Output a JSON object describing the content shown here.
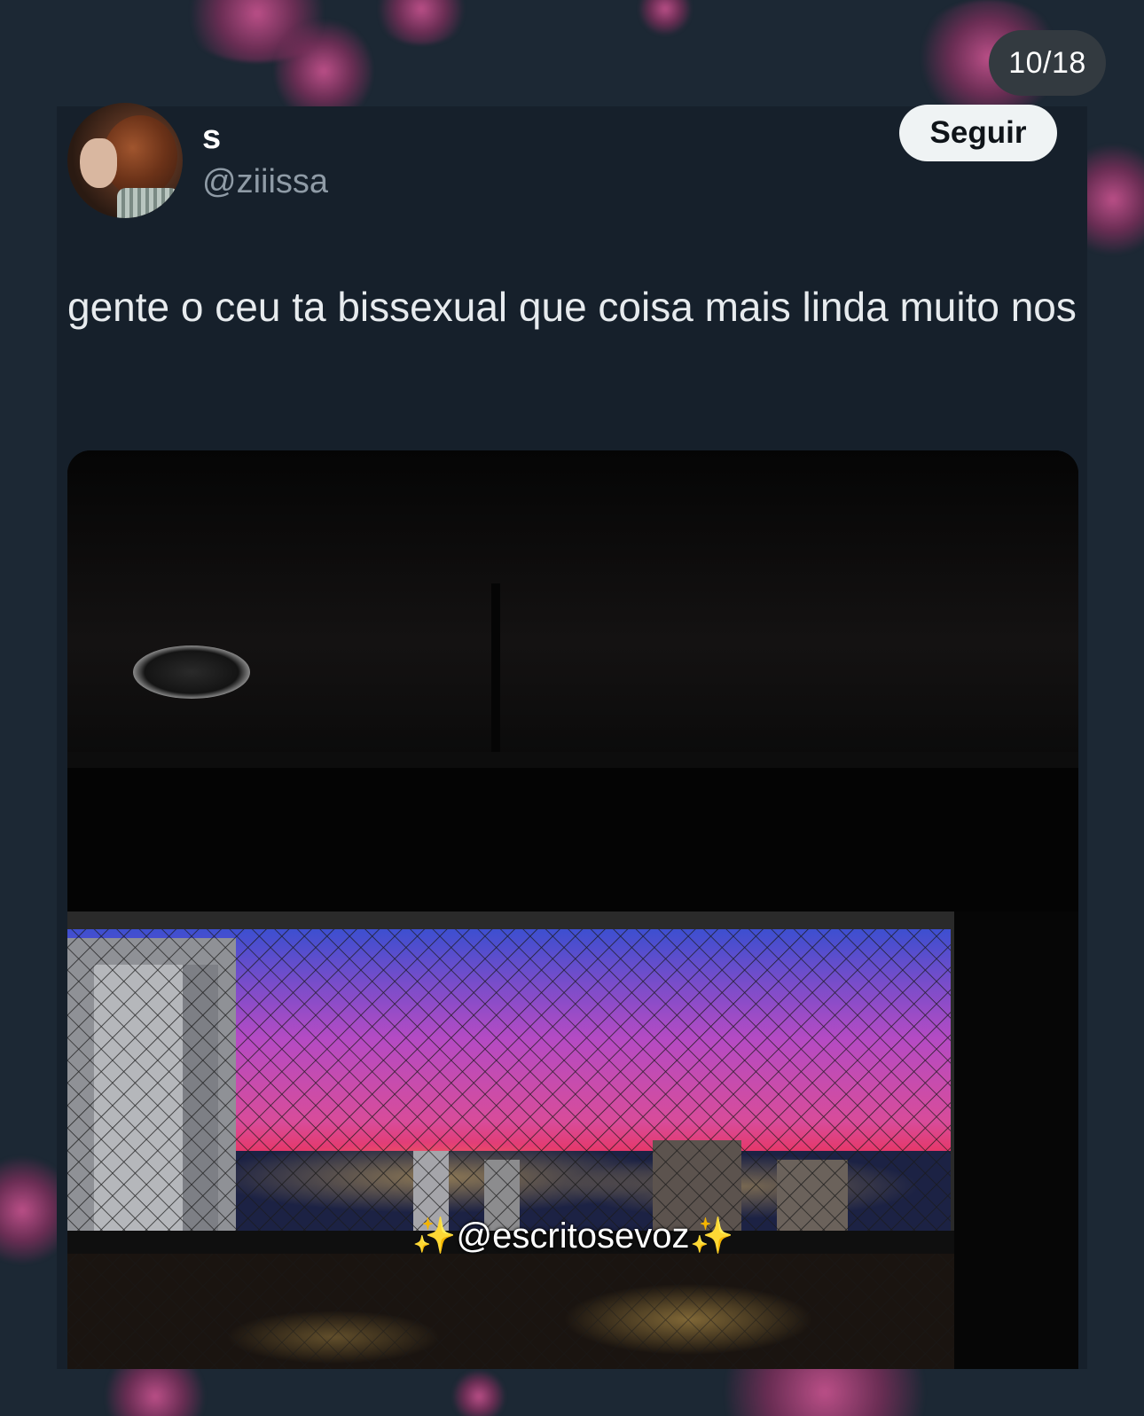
{
  "gallery": {
    "counter": "10/18"
  },
  "tweet": {
    "display_name": "s",
    "handle": "@ziiissa",
    "follow_label": "Seguir",
    "text": "gente o ceu ta bissexual que coisa mais linda muito nos",
    "media_watermark": "@escritosevoz",
    "watermark_sparkle": "✨"
  },
  "colors": {
    "background": "#1c2834",
    "card": "#16202b",
    "follow_button": "#eff3f4",
    "sky_top": "#3d4fd0",
    "sky_middle": "#b44bc4",
    "sky_bottom": "#ef2a48"
  }
}
